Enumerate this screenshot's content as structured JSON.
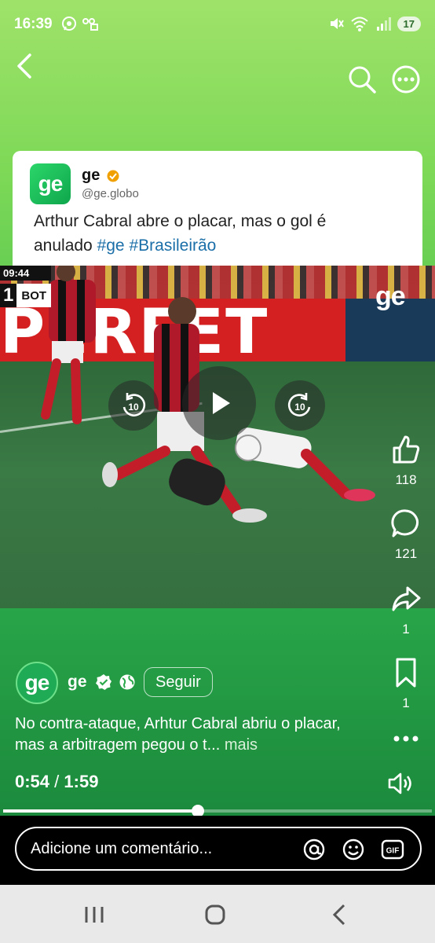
{
  "status_bar": {
    "time": "16:39",
    "battery": "17",
    "icons": [
      "whatsapp-icon",
      "voicemail-icon",
      "mute-icon",
      "wifi-icon",
      "signal-icon"
    ]
  },
  "top_nav": {
    "icons": [
      "back-arrow-icon",
      "search-icon",
      "more-icon"
    ]
  },
  "tweet": {
    "logo_text": "ge",
    "name": "ge",
    "handle": "@ge.globo",
    "text": "Arthur Cabral abre o placar, mas o gol é anulado ",
    "hashtags": [
      "#ge",
      "#Brasileirão"
    ]
  },
  "video": {
    "clock": "09:44",
    "score": "1",
    "team": "BOT",
    "banner_text": "PERFET",
    "overlay_logo": "ge",
    "rewind_label": "10",
    "forward_label": "10"
  },
  "actions": {
    "likes": "118",
    "comments": "121",
    "shares": "1",
    "saves": "1"
  },
  "post": {
    "avatar_text": "ge",
    "author": "ge",
    "follow_label": "Seguir",
    "caption": "No contra-ataque, Arhtur Cabral abriu o placar, mas a arbitragem pegou o t...",
    "more_label": "mais",
    "time_current": "0:54",
    "time_separator": "/",
    "time_total": "1:59",
    "progress_fraction": 0.4538
  },
  "comment_bar": {
    "placeholder": "Adicione um comentário...",
    "gif_label": "GIF"
  },
  "colors": {
    "accent_green": "#1faa55",
    "hashtag_blue": "#1b6fa8"
  }
}
